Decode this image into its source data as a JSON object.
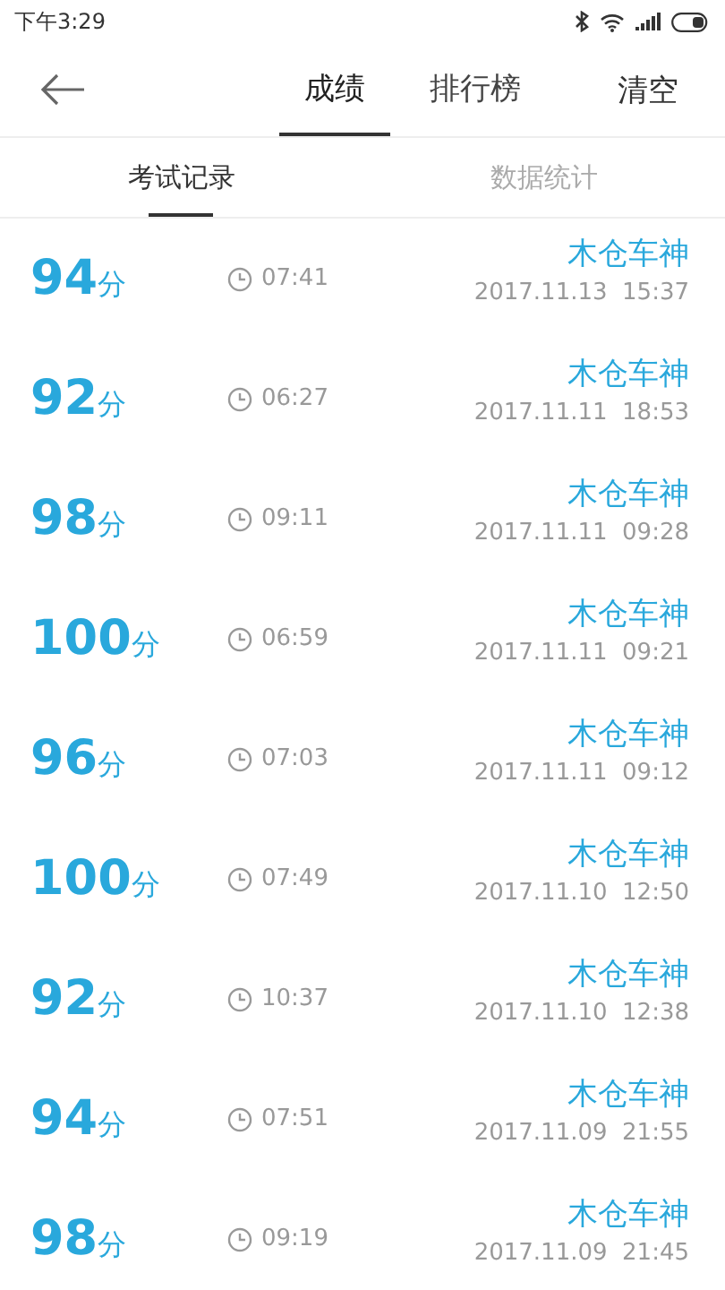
{
  "status_bar": {
    "time": "下午3:29"
  },
  "tabs": [
    {
      "label": "成绩",
      "selected": true
    },
    {
      "label": "排行榜",
      "selected": false
    }
  ],
  "clear_button": "清空",
  "sub_tabs": [
    {
      "label": "考试记录",
      "selected": true
    },
    {
      "label": "数据统计",
      "selected": false
    }
  ],
  "records": [
    {
      "score": "94",
      "unit": "分",
      "duration": "07:41",
      "name": "木仓车神",
      "datetime": "2017.11.13  15:37"
    },
    {
      "score": "92",
      "unit": "分",
      "duration": "06:27",
      "name": "木仓车神",
      "datetime": "2017.11.11  18:53"
    },
    {
      "score": "98",
      "unit": "分",
      "duration": "09:11",
      "name": "木仓车神",
      "datetime": "2017.11.11  09:28"
    },
    {
      "score": "100",
      "unit": "分",
      "duration": "06:59",
      "name": "木仓车神",
      "datetime": "2017.11.11  09:21"
    },
    {
      "score": "96",
      "unit": "分",
      "duration": "07:03",
      "name": "木仓车神",
      "datetime": "2017.11.11  09:12"
    },
    {
      "score": "100",
      "unit": "分",
      "duration": "07:49",
      "name": "木仓车神",
      "datetime": "2017.11.10  12:50"
    },
    {
      "score": "92",
      "unit": "分",
      "duration": "10:37",
      "name": "木仓车神",
      "datetime": "2017.11.10  12:38"
    },
    {
      "score": "94",
      "unit": "分",
      "duration": "07:51",
      "name": "木仓车神",
      "datetime": "2017.11.09  21:55"
    },
    {
      "score": "98",
      "unit": "分",
      "duration": "09:19",
      "name": "木仓车神",
      "datetime": "2017.11.09  21:45"
    }
  ]
}
